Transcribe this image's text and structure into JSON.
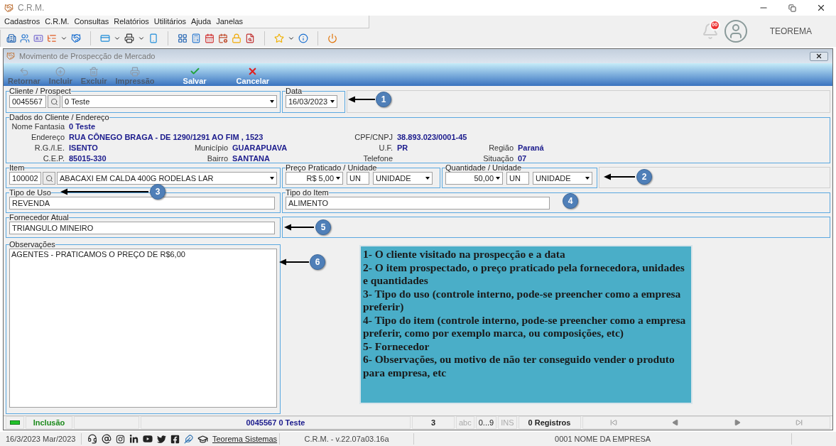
{
  "app": {
    "title": "C.R.M.",
    "notifications": "00",
    "user": "TEOREMA"
  },
  "menu": [
    "Cadastros",
    "C.R.M.",
    "Consultas",
    "Relatórios",
    "Utilitários",
    "Ajuda",
    "Janelas"
  ],
  "child_window": {
    "title": "Movimento de Prospecção de Mercado"
  },
  "actions": [
    {
      "label": "Retornar",
      "kind": "back",
      "disabled": true
    },
    {
      "label": "Incluir",
      "kind": "add",
      "disabled": true
    },
    {
      "label": "Excluir",
      "kind": "delete",
      "disabled": true
    },
    {
      "label": "Impressão",
      "kind": "print",
      "disabled": true
    },
    {
      "label": "Salvar",
      "kind": "save",
      "disabled": false
    },
    {
      "label": "Cancelar",
      "kind": "cancel",
      "disabled": false
    }
  ],
  "form": {
    "client": {
      "legend": "Cliente / Prospect",
      "code": "0045567",
      "name": "0 Teste"
    },
    "date": {
      "legend": "Data",
      "value": "16/03/2023"
    },
    "details": {
      "legend": "Dados do Cliente / Endereço",
      "rows": [
        [
          {
            "label": "Nome Fantasia",
            "value": "0 Teste"
          }
        ],
        [
          {
            "label": "Endereço",
            "value": "RUA CÔNEGO BRAGA - DE 1290/1291 AO FIM , 1523"
          },
          {},
          {
            "label": "CPF/CNPJ",
            "value": "38.893.023/0001-45"
          }
        ],
        [
          {
            "label": "R.G./I.E.",
            "value": "ISENTO"
          },
          {
            "label": "Município",
            "value": "GUARAPUAVA"
          },
          {
            "label": "U.F.",
            "value": "PR"
          },
          {
            "label": "Região",
            "value": "Paraná"
          }
        ],
        [
          {
            "label": "C.E.P.",
            "value": "85015-330"
          },
          {
            "label": "Bairro",
            "value": "SANTANA"
          },
          {
            "label": "Telefone"
          },
          {
            "label": "Situação",
            "value": "07"
          }
        ]
      ]
    },
    "item": {
      "legend": "Item",
      "code": "100002",
      "name": "ABACAXI EM CALDA 400G RODELAS LAR"
    },
    "price": {
      "legend": "Preço Praticado / Unidade",
      "value": "R$ 5,00",
      "unit": "UN",
      "unit_name": "UNIDADE"
    },
    "quantity": {
      "legend": "Quantidade / Unidade",
      "value": "50,00",
      "unit": "UN",
      "unit_name": "UNIDADE"
    },
    "use_type": {
      "legend": "Tipo de Uso",
      "value": "REVENDA"
    },
    "item_type": {
      "legend": "Tipo do Item",
      "value": "ALIMENTO"
    },
    "supplier": {
      "legend": "Fornecedor Atual",
      "value": "TRIANGULO MINEIRO"
    },
    "notes": {
      "legend": "Observações",
      "value": "AGENTES - PRATICAMOS O PREÇO DE R$6,00"
    }
  },
  "annotations": {
    "markers": [
      {
        "number": "1",
        "arrow": true
      },
      {
        "number": "2",
        "arrow": true
      },
      {
        "number": "3",
        "arrow": true
      },
      {
        "number": "4",
        "arrow": false
      },
      {
        "number": "5",
        "arrow": true
      },
      {
        "number": "6",
        "arrow": true
      }
    ],
    "notes": [
      "1- O cliente visitado na prospecção e a data",
      "2- O item prospectado, o preço praticado pela fornecedora, unidades e quantidades",
      "3- Tipo do uso (controle interno, pode-se preencher como a empresa preferir)",
      "4- Tipo do item (controle interno, pode-se preencher como  a empresa preferir, como por exemplo marca, ou  composições, etc)",
      "5- Fornecedor",
      "6- Observações, ou motivo de não ter conseguido vender o produto para empresa, etc"
    ]
  },
  "status_bar": {
    "mode": "Inclusão",
    "record": "0045567 0 Teste",
    "count": "3",
    "indicators": [
      {
        "label": "abc",
        "on": false
      },
      {
        "label": "0...9",
        "on": true
      },
      {
        "label": "INS",
        "on": false
      }
    ],
    "records": "0 Registros"
  },
  "footer": {
    "date": "16/3/2023 Mar/2023",
    "link": "Teorema Sistemas",
    "version": "C.R.M. - v.22.07a03.16a",
    "company": "0001 NOME DA EMPRESA"
  }
}
